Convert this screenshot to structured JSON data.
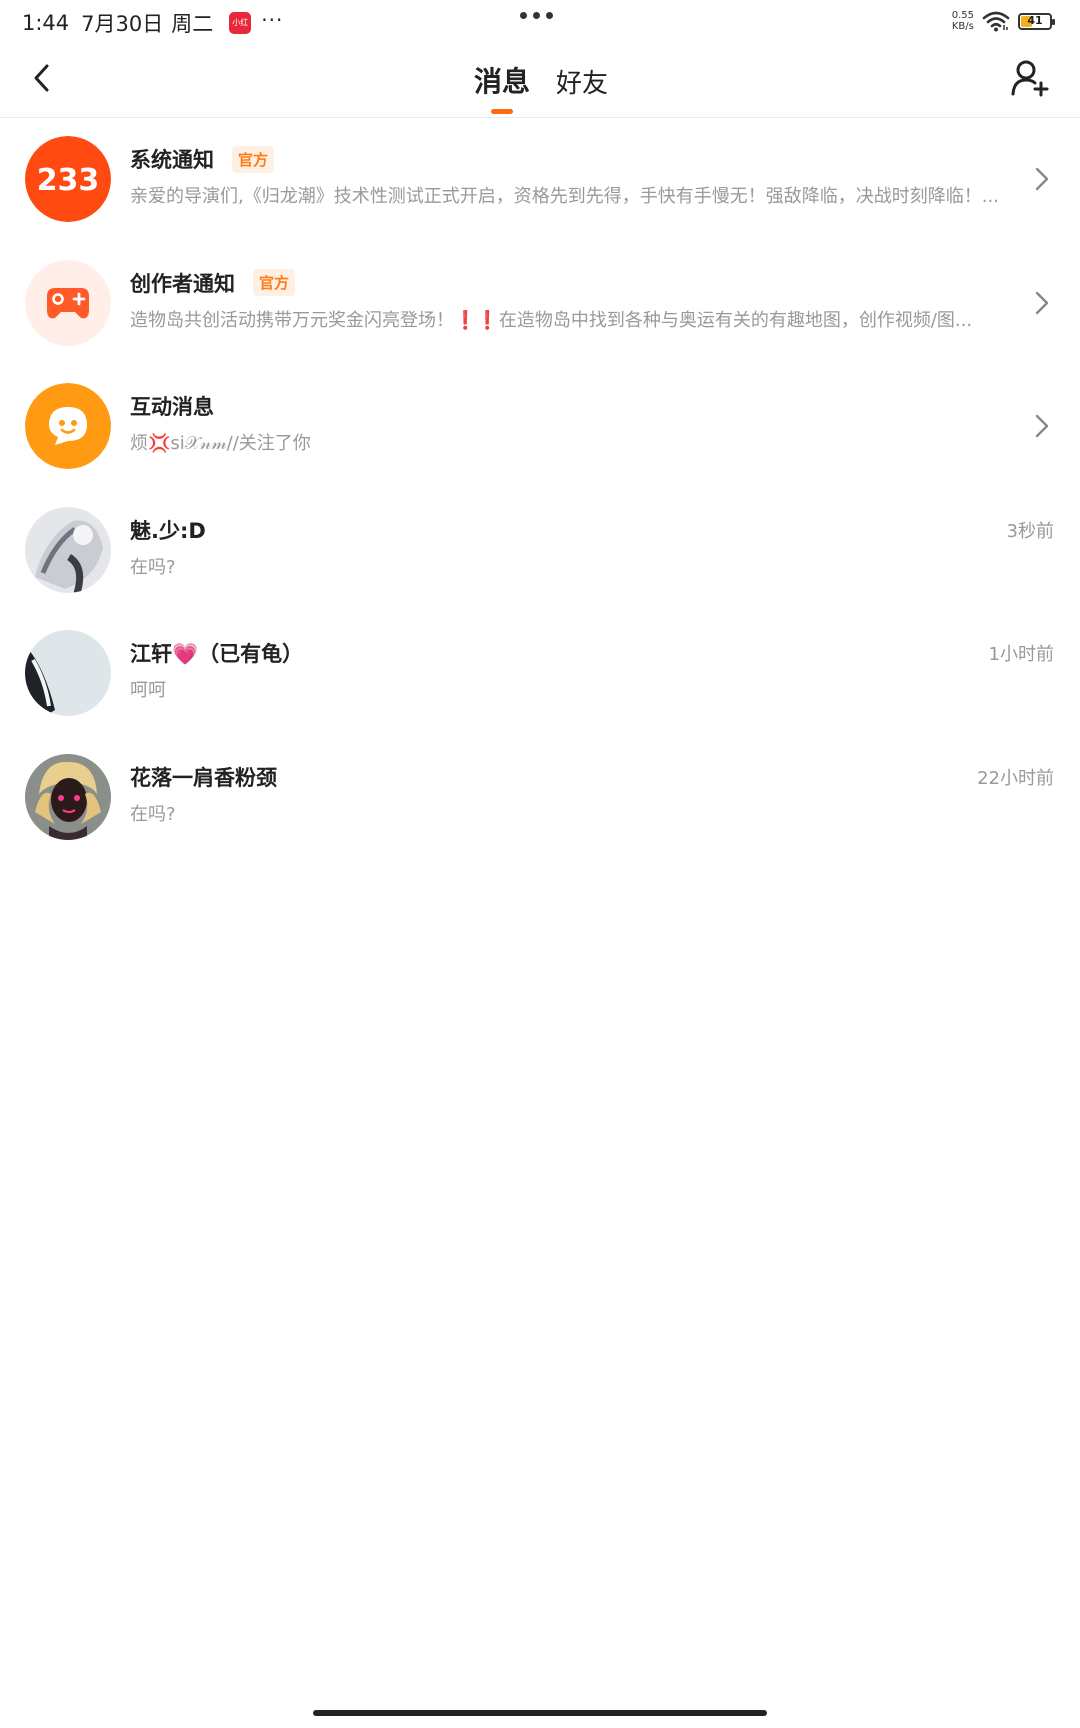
{
  "status_bar": {
    "time": "1:44",
    "date": "7月30日",
    "weekday": "周二",
    "app_icon_text": "小红书",
    "more": "···",
    "net_speed_value": "0.55",
    "net_speed_unit": "KB/s",
    "battery_level": "41",
    "battery_fill_fraction": 0.41
  },
  "header": {
    "tabs": [
      {
        "label": "消息",
        "active": true
      },
      {
        "label": "好友",
        "active": false
      }
    ]
  },
  "colors": {
    "accent": "#ff6a10",
    "official_badge_text": "#ff7a1a",
    "official_badge_bg": "#fff0e4"
  },
  "messages": [
    {
      "title": "系统通知",
      "badge": "官方",
      "preview": "亲爱的导演们,《归龙潮》技术性测试正式开启，资格先到先得，手快有手慢无！强敌降临，决战时刻降临！...",
      "avatar_text": "233",
      "icon": "233-logo-icon"
    },
    {
      "title": "创作者通知",
      "badge": "官方",
      "preview": "造物岛共创活动携带万元奖金闪亮登场！❗❗在造物岛中找到各种与奥运有关的有趣地图，创作视频/图...",
      "icon": "gamepad-icon"
    },
    {
      "title": "互动消息",
      "preview": "烦💢si𝒳𝓃𝓂//关注了你",
      "icon": "chat-bubble-icon"
    },
    {
      "title": "魅.少:D",
      "preview": "在吗?",
      "time": "3秒前"
    },
    {
      "title": "江轩💗（已有龟）",
      "preview": "呵呵",
      "time": "1小时前"
    },
    {
      "title": "花落一肩香粉颈",
      "preview": "在吗?",
      "time": "22小时前"
    }
  ]
}
